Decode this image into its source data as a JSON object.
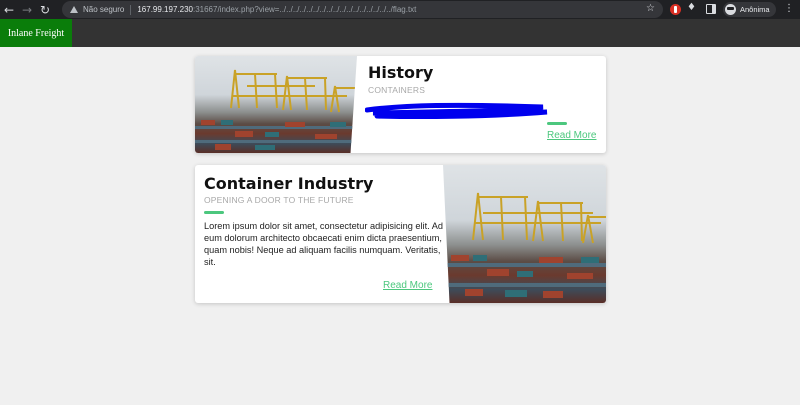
{
  "browser": {
    "insecure_label": "Não seguro",
    "url_host": "167.99.197.230",
    "url_path": ":31667/index.php?view=../../../../../../../../../../../../../../../../../flag.txt",
    "profile_label": "Anônima"
  },
  "site": {
    "brand": "Inlane Freight",
    "brand_color": "#0a7d0a",
    "accent_color": "#4cc77e"
  },
  "cards": [
    {
      "title": "History",
      "subtitle": "CONTAINERS",
      "read_more": "Read More"
    },
    {
      "title": "Container Industry",
      "subtitle": "OPENING A DOOR TO THE FUTURE",
      "body": "Lorem ipsum dolor sit amet, consectetur adipisicing elit. Ad eum dolorum architecto obcaecati enim dicta praesentium, quam nobis! Neque ad aliquam facilis numquam. Veritatis, sit.",
      "read_more": "Read More"
    }
  ]
}
